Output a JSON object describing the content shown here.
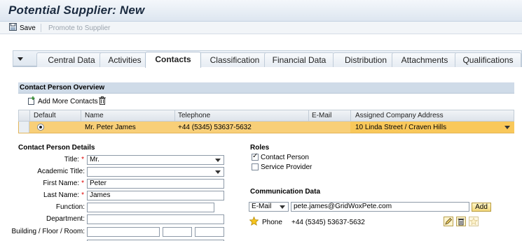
{
  "page": {
    "title": "Potential Supplier: New"
  },
  "toolbar": {
    "save_label": "Save",
    "promote_label": "Promote to Supplier"
  },
  "tabs": [
    {
      "label": "Central Data",
      "active": false
    },
    {
      "label": "Activities",
      "active": false
    },
    {
      "label": "Contacts",
      "active": true
    },
    {
      "label": "Classification",
      "active": false
    },
    {
      "label": "Financial Data",
      "active": false
    },
    {
      "label": "Distribution",
      "active": false
    },
    {
      "label": "Attachments",
      "active": false
    },
    {
      "label": "Qualifications",
      "active": false
    }
  ],
  "overview": {
    "title": "Contact Person Overview",
    "add_label": "Add More Contacts",
    "columns": {
      "default": "Default",
      "name": "Name",
      "telephone": "Telephone",
      "email": "E-Mail",
      "address": "Assigned Company Address"
    },
    "row": {
      "name": "Mr. Peter James",
      "telephone": "+44 (5345) 53637-5632",
      "email": "",
      "address": "10 Linda Street / Craven Hills"
    }
  },
  "details": {
    "title": "Contact Person Details",
    "title_label": "Title:",
    "title_value": "Mr.",
    "academic_label": "Academic Title:",
    "academic_value": "",
    "first_label": "First Name:",
    "first_value": "Peter",
    "last_label": "Last Name:",
    "last_value": "James",
    "function_label": "Function:",
    "function_value": "",
    "department_label": "Department:",
    "department_value": "",
    "building_label": "Building / Floor / Room:"
  },
  "roles": {
    "title": "Roles",
    "items": [
      {
        "label": "Contact Person",
        "checked": true
      },
      {
        "label": "Service Provider",
        "checked": false
      }
    ]
  },
  "communication": {
    "title": "Communication Data",
    "type_value": "E-Mail",
    "email_value": "pete.james@GridWoxPete.com",
    "add_label": "Add",
    "phone_label": "Phone",
    "phone_value": "+44 (5345) 53637-5632"
  }
}
